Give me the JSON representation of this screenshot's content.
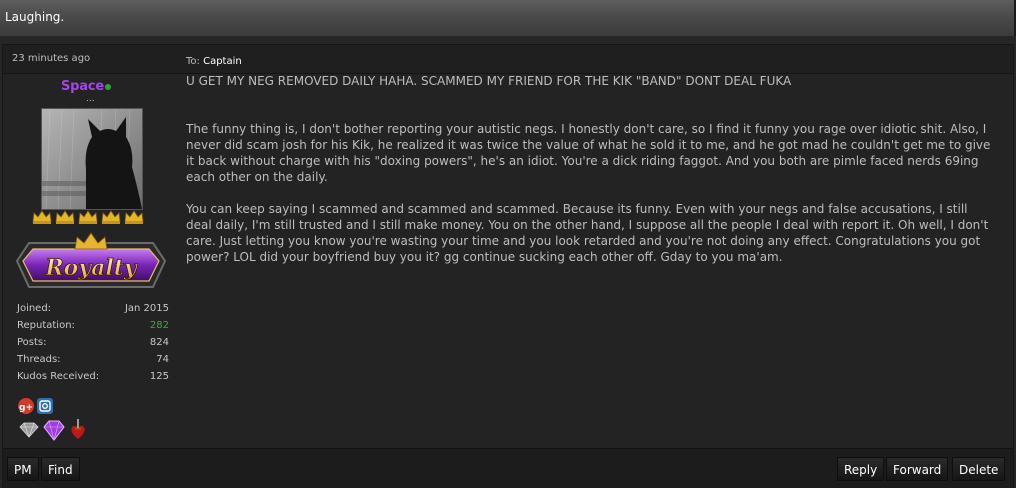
{
  "thread": {
    "title": "Laughing."
  },
  "post": {
    "time": "23 minutes ago",
    "author": {
      "username": "Space",
      "user_title": "...",
      "online": true,
      "username_color": "#a445e6",
      "rank_badge_text": "Royalty",
      "stars": 5,
      "stats": [
        {
          "label": "Joined:",
          "value": "Jan 2015"
        },
        {
          "label": "Reputation:",
          "value": "282"
        },
        {
          "label": "Posts:",
          "value": "824"
        },
        {
          "label": "Threads:",
          "value": "74"
        },
        {
          "label": "Kudos Received:",
          "value": "125"
        }
      ],
      "reputation_color": "#47a447",
      "social_icons": [
        "google-plus-icon",
        "instagram-icon"
      ],
      "award_icons": [
        "diamond-icon",
        "purple-gem-icon",
        "heart-dagger-icon"
      ]
    },
    "to_label": "To:",
    "to_name": "Captain",
    "quote": "U GET MY NEG REMOVED DAILY HAHA. SCAMMED MY FRIEND FOR THE KIK \"BAND\" DONT DEAL FUKA",
    "paragraphs": [
      "The funny thing is, I don't bother reporting your autistic negs. I honestly don't care, so I find it funny you rage over idiotic shit. Also, I never did scam josh for his Kik, he realized it was twice the value of what he sold it to me, and he got mad he couldn't get me to give it back without charge with his \"doxing powers\", he's an idiot. You're a dick riding faggot. And you both are pimle faced nerds 69ing each other on the daily.",
      "You can keep saying I scammed and scammed and scammed. Because its funny. Even with your negs and false accusations, I still deal daily, I'm still trusted and I still make money. You on the other hand, I suppose all the people I deal with report it. Oh well, I don't care. Just letting you know you're wasting your time and you look retarded and you're not doing any effect. Congratulations you got power? LOL did your boyfriend buy you it? gg continue sucking each other off. Gday to you ma'am."
    ]
  },
  "buttons": {
    "pm": "PM",
    "find": "Find",
    "reply": "Reply",
    "forward": "Forward",
    "delete": "Delete"
  }
}
